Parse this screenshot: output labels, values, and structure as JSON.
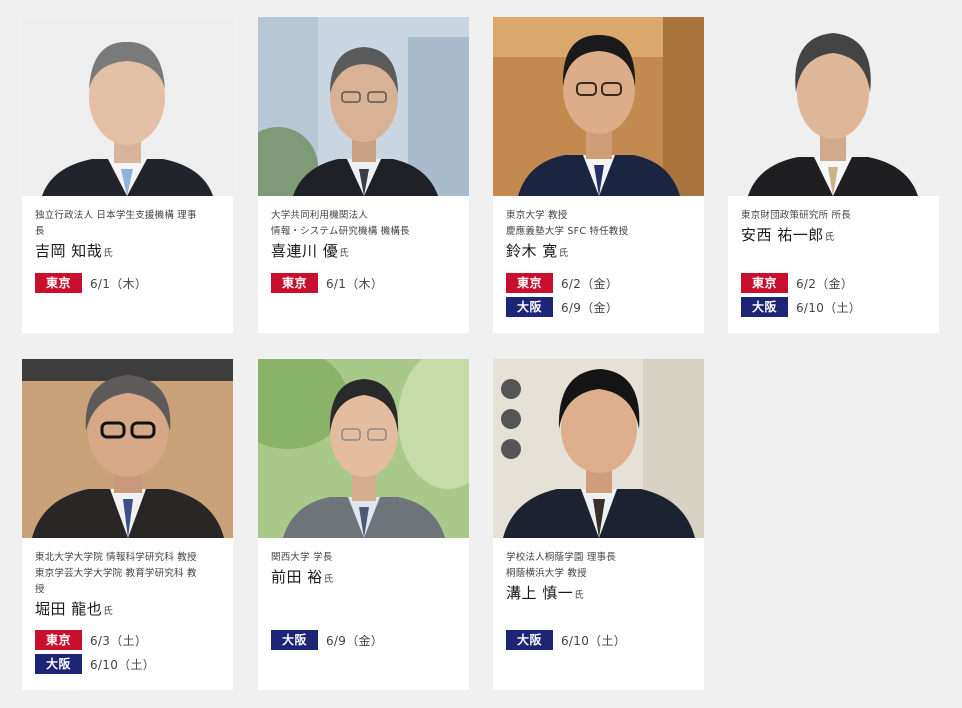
{
  "colors": {
    "tokyo": "#c8102e",
    "osaka": "#1d2576",
    "page_bg": "#f0f0f0",
    "card_bg": "#ffffff"
  },
  "speakers": [
    {
      "affiliation": "独立行政法人 日本学生支援機構 理事\n長",
      "name": "吉岡 知哉",
      "suffix": "氏",
      "sessions": [
        {
          "city": "東京",
          "city_key": "tokyo",
          "date": "6/1（木）"
        }
      ]
    },
    {
      "affiliation": "大学共同利用機関法人\n情報・システム研究機構 機構長",
      "name": "喜連川 優",
      "suffix": "氏",
      "sessions": [
        {
          "city": "東京",
          "city_key": "tokyo",
          "date": "6/1（木）"
        }
      ]
    },
    {
      "affiliation": "東京大学 教授\n慶應義塾大学 SFC 特任教授",
      "name": "鈴木 寛",
      "suffix": "氏",
      "sessions": [
        {
          "city": "東京",
          "city_key": "tokyo",
          "date": "6/2（金）"
        },
        {
          "city": "大阪",
          "city_key": "osaka",
          "date": "6/9（金）"
        }
      ]
    },
    {
      "affiliation": "東京財団政策研究所 所長",
      "name": "安西 祐一郎",
      "suffix": "氏",
      "sessions": [
        {
          "city": "東京",
          "city_key": "tokyo",
          "date": "6/2（金）"
        },
        {
          "city": "大阪",
          "city_key": "osaka",
          "date": "6/10（土）"
        }
      ]
    },
    {
      "affiliation": "東北大学大学院 情報科学研究科 教授\n東京学芸大学大学院 教育学研究科 教\n授",
      "name": "堀田 龍也",
      "suffix": "氏",
      "sessions": [
        {
          "city": "東京",
          "city_key": "tokyo",
          "date": "6/3（土）"
        },
        {
          "city": "大阪",
          "city_key": "osaka",
          "date": "6/10（土）"
        }
      ]
    },
    {
      "affiliation": "関西大学 学長",
      "name": "前田 裕",
      "suffix": "氏",
      "sessions": [
        {
          "city": "大阪",
          "city_key": "osaka",
          "date": "6/9（金）"
        }
      ]
    },
    {
      "affiliation": "学校法人桐蔭学園 理事長\n桐蔭横浜大学 教授",
      "name": "溝上 慎一",
      "suffix": "氏",
      "sessions": [
        {
          "city": "大阪",
          "city_key": "osaka",
          "date": "6/10（土）"
        }
      ]
    }
  ]
}
